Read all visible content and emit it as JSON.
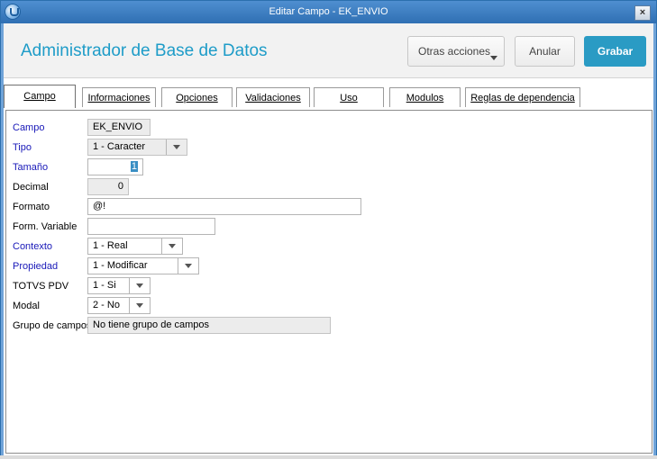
{
  "window": {
    "title": "Editar Campo - EK_ENVIO",
    "close_glyph": "×"
  },
  "header": {
    "app_title": "Administrador de Base de Datos",
    "otras_acciones": "Otras acciones",
    "anular": "Anular",
    "grabar": "Grabar"
  },
  "tabs": [
    {
      "label": "Campo",
      "active": true
    },
    {
      "label": "Informaciones"
    },
    {
      "label": "Opciones"
    },
    {
      "label": "Validaciones"
    },
    {
      "label": "Uso"
    },
    {
      "label": "Modulos"
    },
    {
      "label": "Reglas de dependencia"
    }
  ],
  "form": {
    "campo": {
      "label": "Campo",
      "value": "EK_ENVIO"
    },
    "tipo": {
      "label": "Tipo",
      "value": "1 - Caracter"
    },
    "tamano": {
      "label": "Tamaño",
      "value": "1"
    },
    "decimal": {
      "label": "Decimal",
      "value": "0"
    },
    "formato": {
      "label": "Formato",
      "value": "@!"
    },
    "form_variable": {
      "label": "Form. Variable",
      "value": ""
    },
    "contexto": {
      "label": "Contexto",
      "value": "1 - Real"
    },
    "propiedad": {
      "label": "Propiedad",
      "value": "1 - Modificar"
    },
    "totvs_pdv": {
      "label": "TOTVS PDV",
      "value": "1 - Si"
    },
    "modal": {
      "label": "Modal",
      "value": "2 - No"
    },
    "grupo_campos": {
      "label": "Grupo de campos",
      "value": "No tiene grupo de campos"
    }
  },
  "colors": {
    "accent": "#1e9cc8",
    "primary_button": "#2a9bc4",
    "required_label": "#1818b8",
    "titlebar": "#2f6fb3"
  }
}
